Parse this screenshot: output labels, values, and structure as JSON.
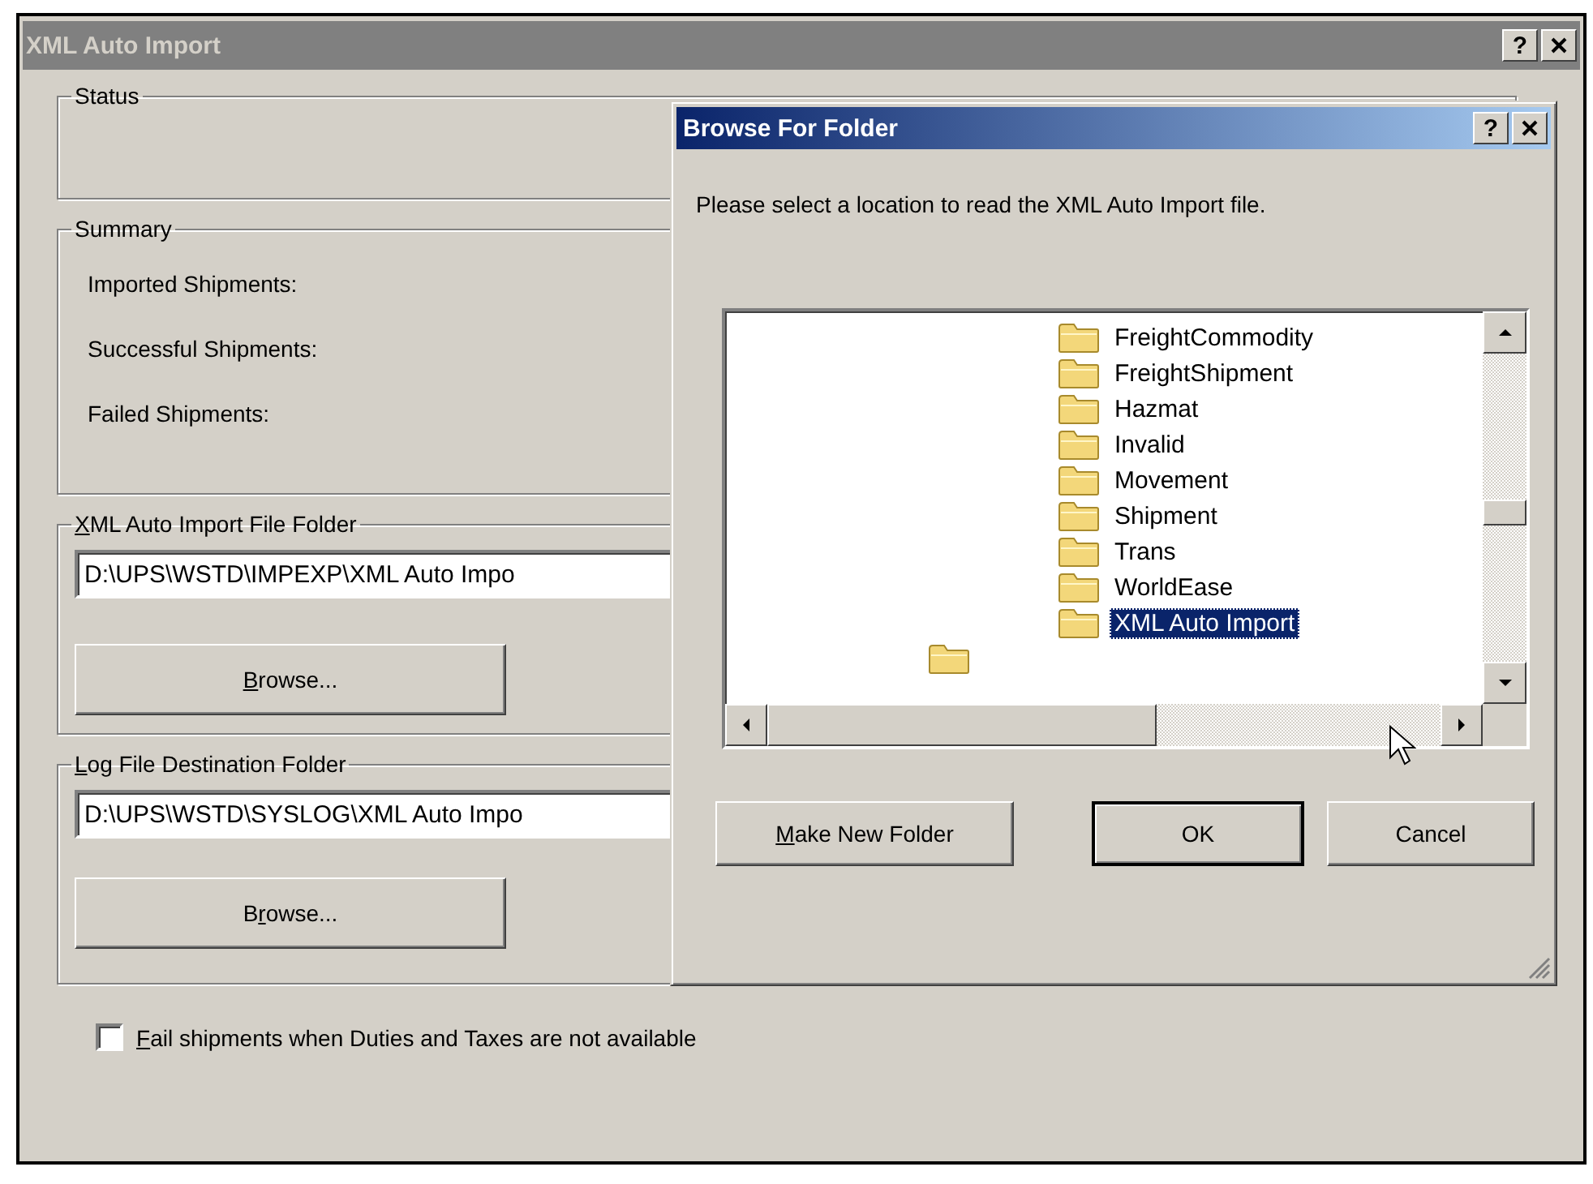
{
  "window": {
    "title": "XML Auto Import",
    "help_button": "?"
  },
  "status": {
    "label": "Status"
  },
  "summary": {
    "label": "Summary",
    "rows": [
      "Imported Shipments:",
      "Successful Shipments:",
      "Failed Shipments:"
    ]
  },
  "folders": [
    {
      "label": {
        "key": "X",
        "after": "ML Auto Import File Folder"
      },
      "path": "D:\\UPS\\WSTD\\IMPEXP\\XML Auto Impo",
      "button": {
        "key": "B",
        "after": "rowse..."
      }
    },
    {
      "label": {
        "key": "L",
        "after": "og File Destination Folder"
      },
      "path": "D:\\UPS\\WSTD\\SYSLOG\\XML Auto Impo",
      "button": {
        "before": "B",
        "key": "r",
        "after": "owse..."
      }
    }
  ],
  "fail_checkbox": {
    "label": {
      "key": "F",
      "after": "ail shipments when Duties and Taxes are not available"
    },
    "checked": false
  },
  "browse_dialog": {
    "title": "Browse For Folder",
    "help_button": "?",
    "prompt": "Please select a location to read the XML Auto Import file.",
    "tree": [
      {
        "label": "FreightCommodity",
        "selected": false
      },
      {
        "label": "FreightShipment",
        "selected": false
      },
      {
        "label": "Hazmat",
        "selected": false
      },
      {
        "label": "Invalid",
        "selected": false
      },
      {
        "label": "Movement",
        "selected": false
      },
      {
        "label": "Shipment",
        "selected": false
      },
      {
        "label": "Trans",
        "selected": false
      },
      {
        "label": "WorldEase",
        "selected": false
      },
      {
        "label": "XML Auto Import",
        "selected": true
      }
    ],
    "buttons": [
      {
        "label": {
          "key": "M",
          "after": "ake New Folder"
        },
        "default": false
      },
      {
        "label": {
          "before": "OK"
        },
        "default": true
      },
      {
        "label": {
          "before": "Cancel"
        },
        "default": false
      }
    ]
  }
}
